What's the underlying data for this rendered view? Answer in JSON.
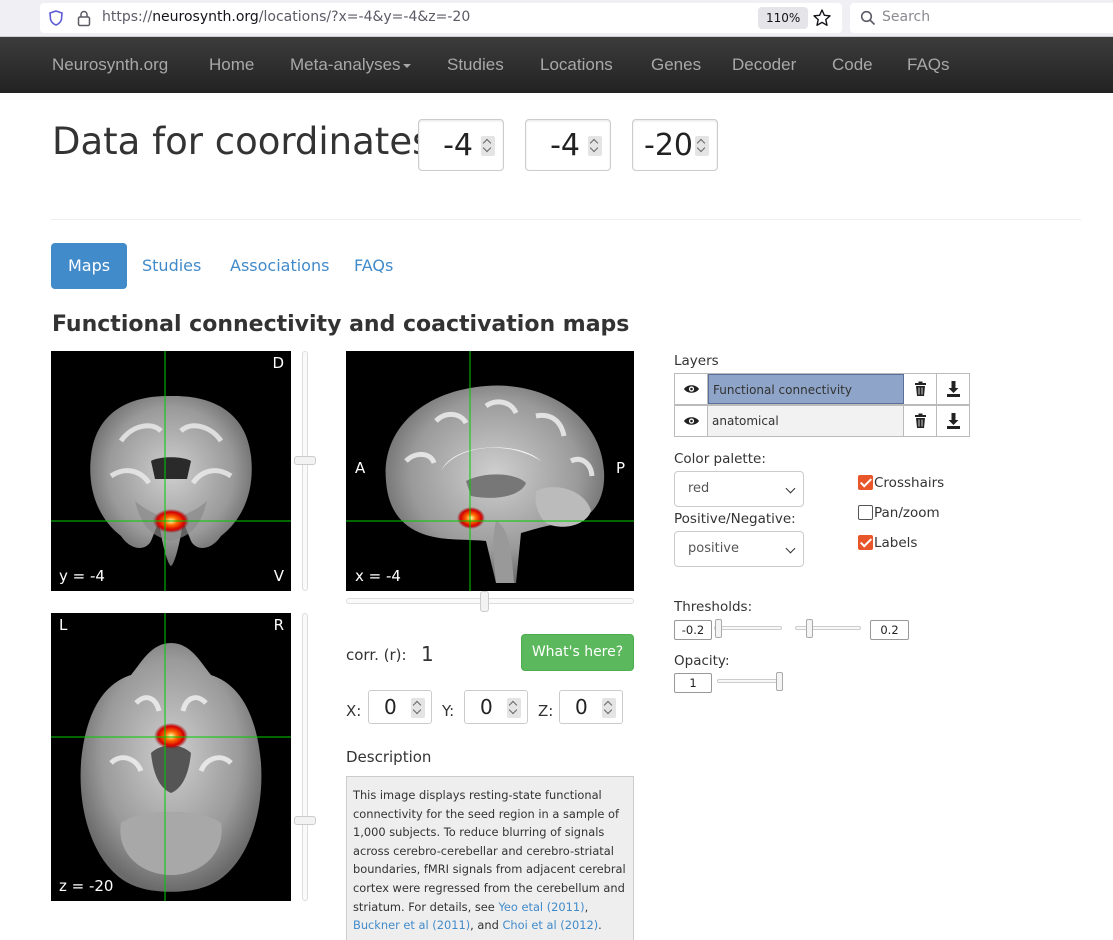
{
  "browser": {
    "url_prefix": "https://",
    "url_host": "neurosynth.org",
    "url_path": "/locations/?x=-4&y=-4&z=-20",
    "zoom": "110%",
    "search_placeholder": "Search"
  },
  "nav": {
    "brand": "Neurosynth.org",
    "items": [
      "Home",
      "Meta-analyses",
      "Studies",
      "Locations",
      "Genes",
      "Decoder",
      "Code",
      "FAQs"
    ]
  },
  "header": {
    "title": "Data for coordinates:",
    "x": "-4",
    "y": "-4",
    "z": "-20"
  },
  "tabs": [
    "Maps",
    "Studies",
    "Associations",
    "FAQs"
  ],
  "section_title": "Functional connectivity and coactivation maps",
  "views": {
    "coronal": {
      "top_right": "D",
      "bottom_right": "V",
      "bottom_left": "y = -4"
    },
    "sagittal": {
      "left": "A",
      "right": "P",
      "bottom_left": "x = -4"
    },
    "axial": {
      "top_left": "L",
      "top_right": "R",
      "bottom_left": "z = -20"
    }
  },
  "corr": {
    "label": "corr. (r):",
    "value": "1"
  },
  "whats_here_label": "What's here?",
  "xyz": {
    "x_label": "X:",
    "x_value": "0",
    "y_label": "Y:",
    "y_value": "0",
    "z_label": "Z:",
    "z_value": "0"
  },
  "description": {
    "label": "Description",
    "text": "This image displays resting-state functional connectivity for the seed region in a sample of 1,000 subjects. To reduce blurring of signals across cerebro-cerebellar and cerebro-striatal boundaries, fMRI signals from adjacent cerebral cortex were regressed from the cerebellum and striatum. For details, see ",
    "link1": "Yeo etal (2011)",
    "sep1": ",",
    "link2": "Buckner et al (2011)",
    "sep2": ", and ",
    "link3": "Choi et al (2012)",
    "end": "."
  },
  "layers": {
    "label": "Layers",
    "items": [
      {
        "name": "Functional connectivity",
        "selected": true
      },
      {
        "name": "anatomical",
        "selected": false
      }
    ]
  },
  "color_palette": {
    "label": "Color palette:",
    "value": "red"
  },
  "pos_neg": {
    "label": "Positive/Negative:",
    "value": "positive"
  },
  "checkboxes": [
    {
      "label": "Crosshairs",
      "checked": true
    },
    {
      "label": "Pan/zoom",
      "checked": false
    },
    {
      "label": "Labels",
      "checked": true
    }
  ],
  "thresholds": {
    "label": "Thresholds:",
    "neg": "-0.2",
    "pos": "0.2"
  },
  "opacity": {
    "label": "Opacity:",
    "value": "1"
  },
  "colors": {
    "nav_bg": "#2b2b2b",
    "accent": "#428bca",
    "button_green": "#5cb85c",
    "check_orange": "#e8562a",
    "crosshair": "#00cc00"
  }
}
